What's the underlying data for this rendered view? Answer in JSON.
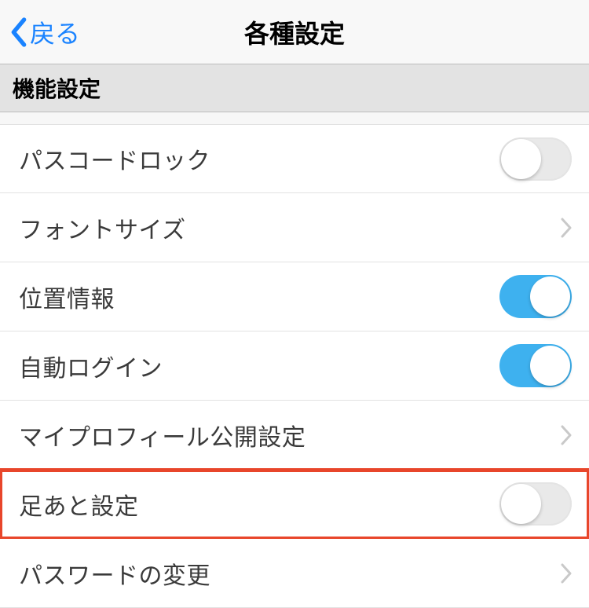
{
  "nav": {
    "back": "戻る",
    "title": "各種設定"
  },
  "section": "機能設定",
  "rows": [
    {
      "label": "パスコードロック"
    },
    {
      "label": "フォントサイズ"
    },
    {
      "label": "位置情報"
    },
    {
      "label": "自動ログイン"
    },
    {
      "label": "マイプロフィール公開設定"
    },
    {
      "label": "足あと設定"
    },
    {
      "label": "パスワードの変更"
    }
  ]
}
